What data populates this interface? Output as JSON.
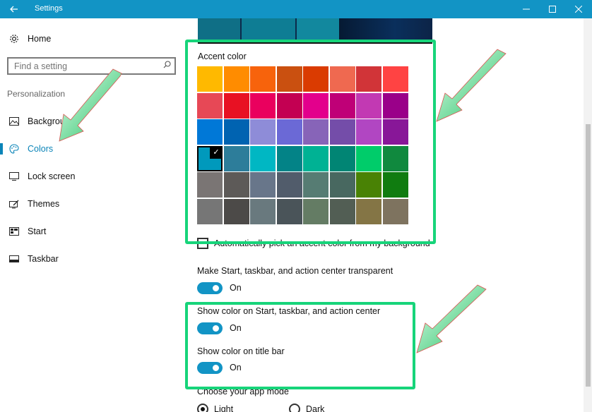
{
  "window": {
    "title": "Settings",
    "back_icon": "back-arrow-icon",
    "controls": [
      "minimize-icon",
      "maximize-icon",
      "close-icon"
    ]
  },
  "sidebar": {
    "home_label": "Home",
    "search_placeholder": "Find a setting",
    "section_heading": "Personalization",
    "items": [
      {
        "label": "Background",
        "icon": "picture-icon"
      },
      {
        "label": "Colors",
        "icon": "palette-icon",
        "active": true
      },
      {
        "label": "Lock screen",
        "icon": "lock-screen-icon"
      },
      {
        "label": "Themes",
        "icon": "themes-icon"
      },
      {
        "label": "Start",
        "icon": "start-icon"
      },
      {
        "label": "Taskbar",
        "icon": "taskbar-icon"
      }
    ]
  },
  "main": {
    "accent_color_title": "Accent color",
    "accent_colors": [
      "#ffb900",
      "#ff8c00",
      "#f7630c",
      "#ca5010",
      "#da3b01",
      "#ef6950",
      "#d13438",
      "#ff4343",
      "#e74856",
      "#e81123",
      "#ea005e",
      "#c30052",
      "#e3008c",
      "#bf0077",
      "#c239b3",
      "#9a0089",
      "#0078d7",
      "#0063b1",
      "#8e8cd8",
      "#6b69d6",
      "#8764b8",
      "#744da9",
      "#b146c2",
      "#881798",
      "#0099bc",
      "#2d7d9a",
      "#00b7c3",
      "#038387",
      "#00b294",
      "#018574",
      "#00cc6a",
      "#10893e",
      "#7a7574",
      "#5d5a58",
      "#68768a",
      "#515c6b",
      "#567c73",
      "#486860",
      "#498205",
      "#107c10",
      "#767676",
      "#4c4a48",
      "#69797e",
      "#4a5459",
      "#647c64",
      "#525e54",
      "#847545",
      "#7e735f"
    ],
    "selected_accent_index": 24,
    "auto_pick_label": "Automatically pick an accent color from my background",
    "transparent_label": "Make Start, taskbar, and action center transparent",
    "transparent_state": "On",
    "show_color_start_label": "Show color on Start, taskbar, and action center",
    "show_color_start_state": "On",
    "show_color_title_label": "Show color on title bar",
    "show_color_title_state": "On",
    "app_mode_label": "Choose your app mode",
    "app_mode_options": [
      "Light",
      "Dark"
    ],
    "app_mode_selected": "Light"
  },
  "colors": {
    "title_bar": "#1294c5",
    "accent_text": "#0a84b8",
    "toggle_on": "#1294c5",
    "highlight_box": "#17d47a"
  }
}
